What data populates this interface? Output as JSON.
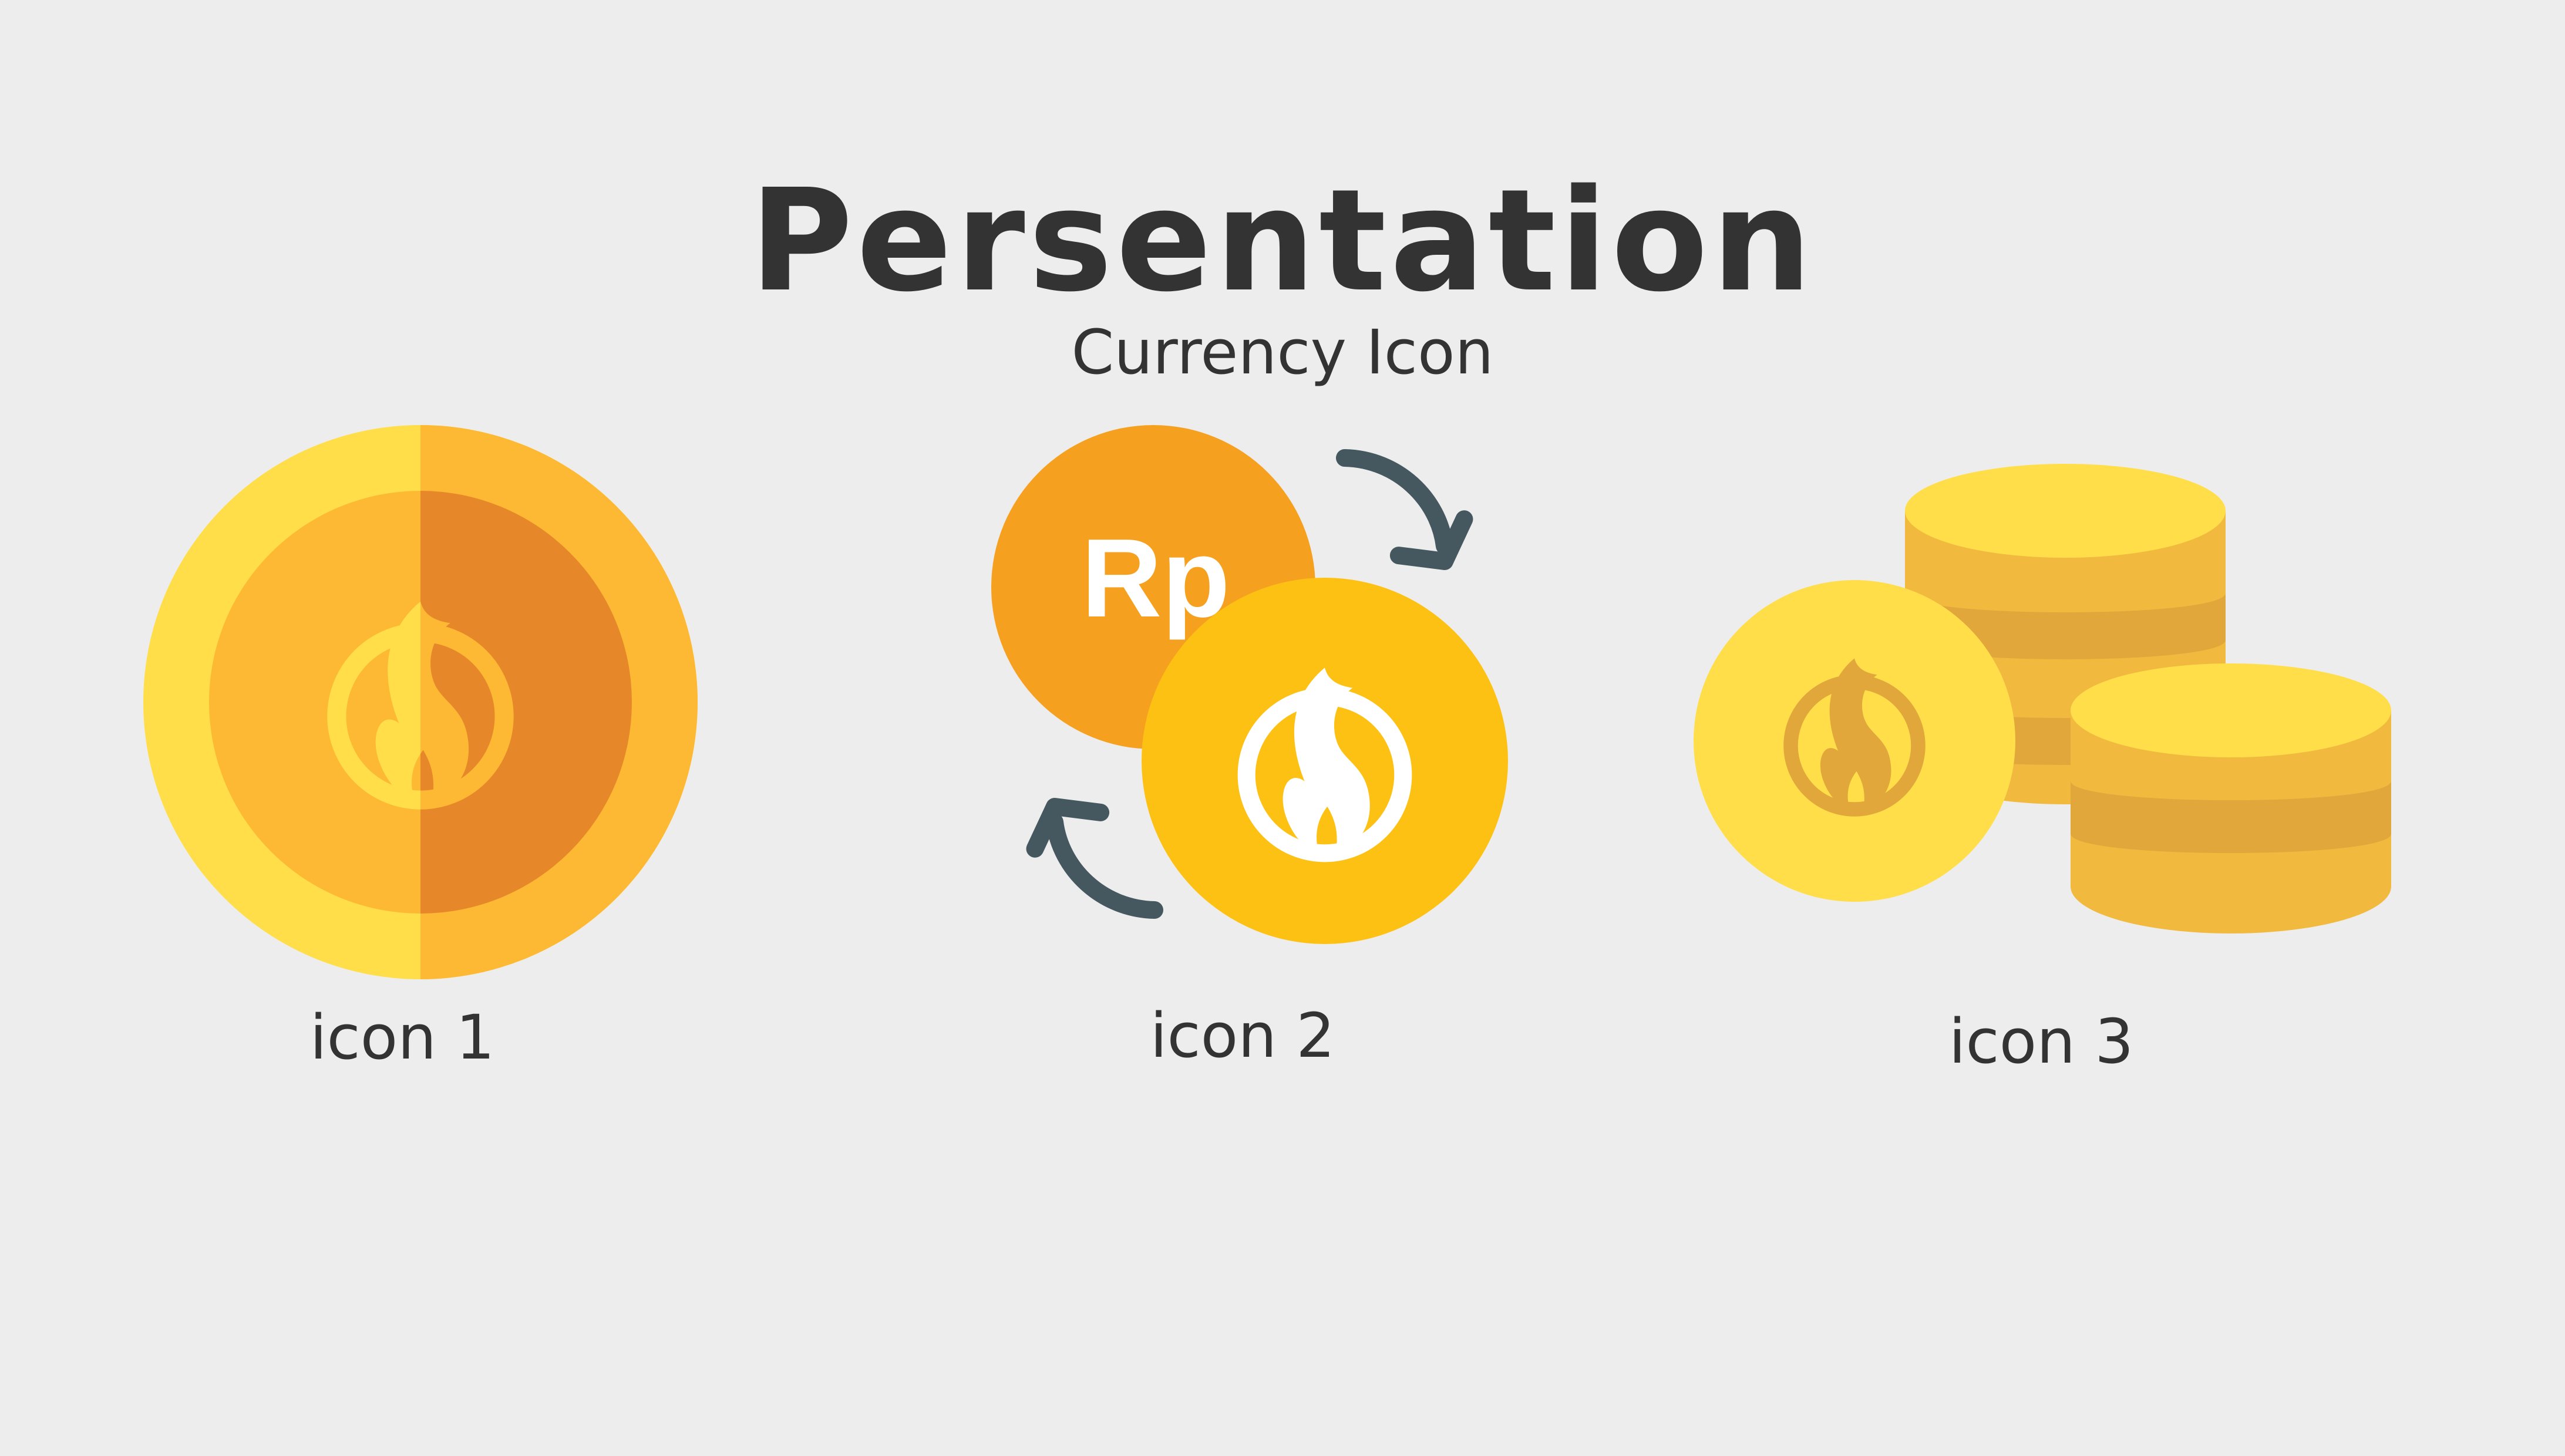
{
  "header": {
    "title": "Persentation",
    "subtitle": "Currency Icon"
  },
  "icons": [
    {
      "name": "flame-coin-icon",
      "caption": "icon 1"
    },
    {
      "name": "rupiah-exchange-icon",
      "caption": "icon 2",
      "currency_label": "Rp"
    },
    {
      "name": "coin-stack-icon",
      "caption": "icon 3"
    }
  ],
  "colors": {
    "background": "#ededed",
    "text": "#333333",
    "coin_light": "#ffde4a",
    "coin_mid": "#fdb934",
    "coin_dark": "#e6872a",
    "coin_orange": "#f6a020",
    "coin_yellow": "#fdc113",
    "arrow": "#45575f",
    "stack_band": "#f2b93f",
    "stack_shadow": "#e2a73a"
  }
}
